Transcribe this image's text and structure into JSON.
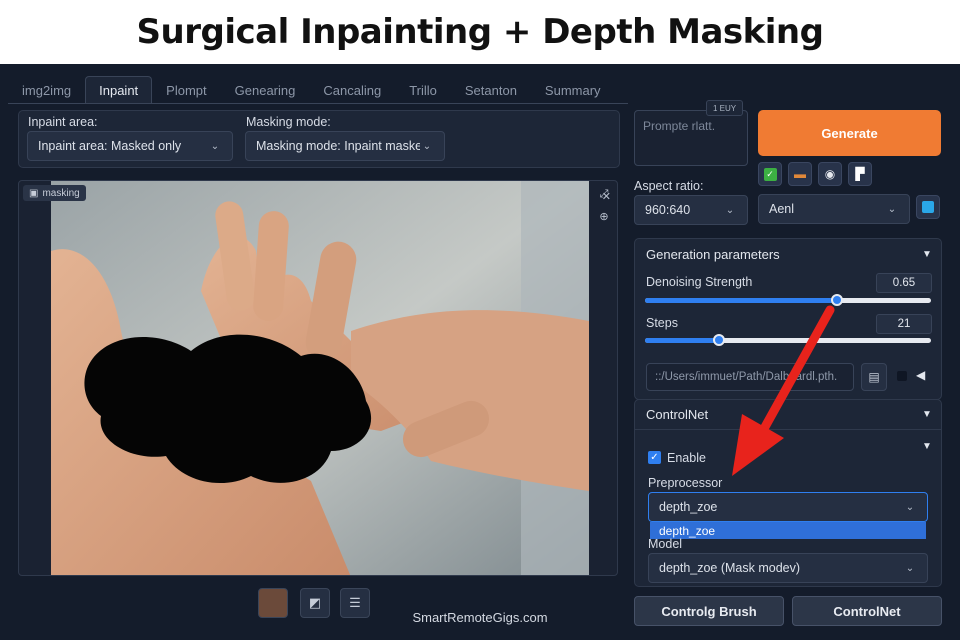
{
  "banner": {
    "title": "Surgical Inpainting + Depth Masking"
  },
  "tabs": [
    {
      "label": "img2img"
    },
    {
      "label": "Inpaint",
      "active": true
    },
    {
      "label": "Plompt"
    },
    {
      "label": "Genearing"
    },
    {
      "label": "Cancaling"
    },
    {
      "label": "Trillo"
    },
    {
      "label": "Setanton"
    },
    {
      "label": "Summary"
    }
  ],
  "inpaint_options": {
    "area_label": "Inpaint area:",
    "area_value": "Inpaint area: Masked only",
    "mode_label": "Masking mode:",
    "mode_value": "Masking mode: Inpaint masked"
  },
  "canvas": {
    "tag": "masking"
  },
  "prompt": {
    "placeholder": "Prompte rlatt.",
    "token_badge": "1 EUY"
  },
  "generate_button": "Generate",
  "aspect": {
    "label": "Aspect ratio:",
    "value": "960:640",
    "second_value": "Aenl"
  },
  "generation_parameters": {
    "title": "Generation parameters",
    "denoise_label": "Denoising Strength",
    "denoise_value": "0.65",
    "denoise_fraction": 0.67,
    "steps_label": "Steps",
    "steps_value": "21",
    "steps_fraction": 0.26,
    "path_value": "::/Users/immuet/Path/Dalboardl.pth."
  },
  "controlnet": {
    "title": "ControlNet",
    "enable_label": "Enable",
    "enabled": true,
    "preprocessor_label": "Preprocessor",
    "preprocessor_value": "depth_zoe",
    "dropdown_option": "depth_zoe",
    "model_label": "Model",
    "model_value": "depth_zoe (Mask modev)"
  },
  "bottom_buttons": {
    "left": "Controlg Brush",
    "right": "ControlNet"
  },
  "watermark": "SmartRemoteGigs.com",
  "colors": {
    "accent": "#f07b33",
    "slider": "#2f7ff0",
    "arrow": "#e8231c"
  }
}
